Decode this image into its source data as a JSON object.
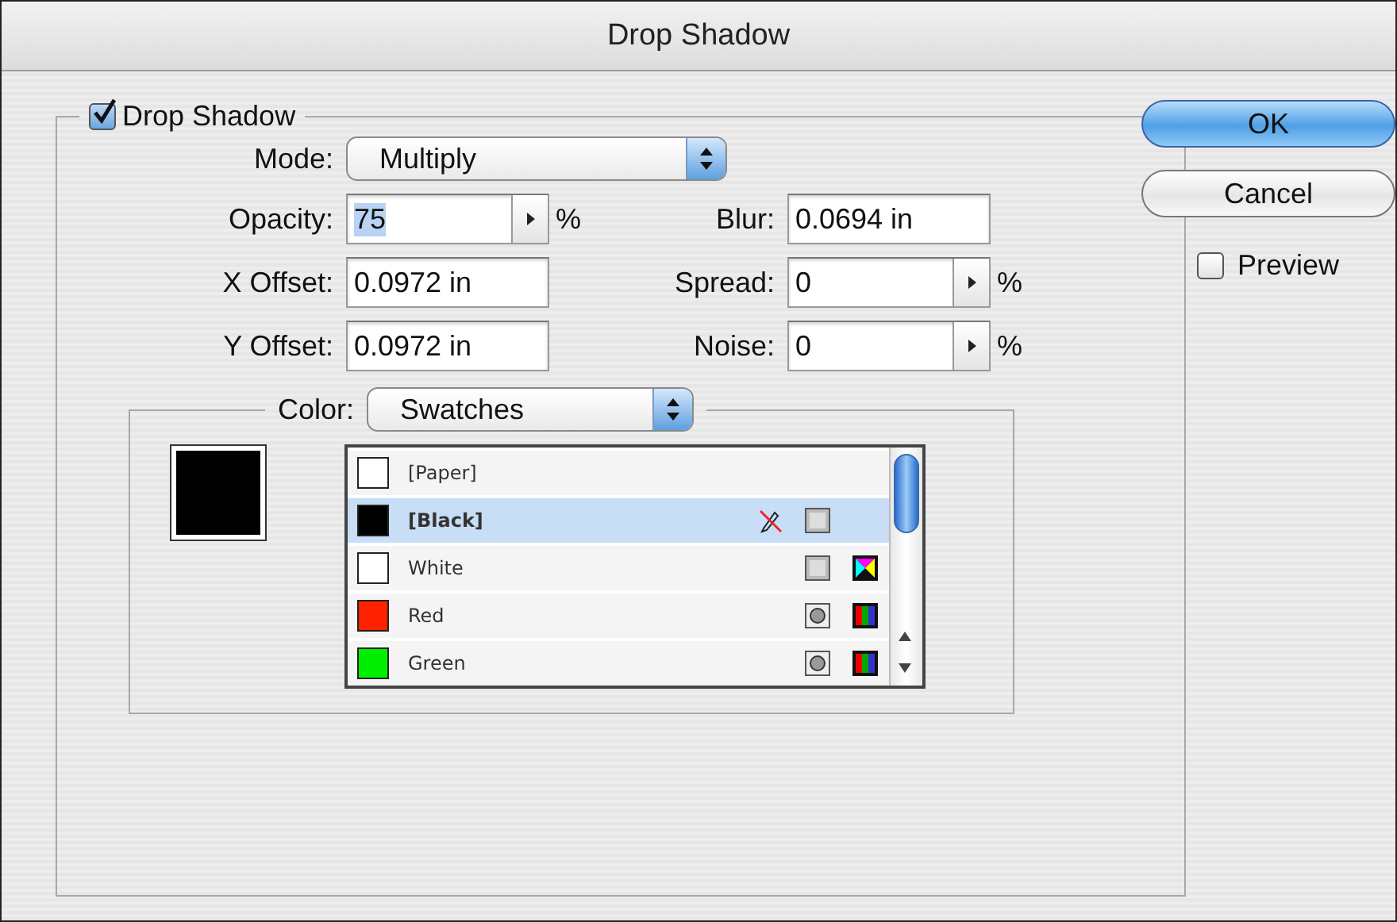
{
  "window": {
    "title": "Drop Shadow"
  },
  "drop_shadow": {
    "label": "Drop Shadow",
    "checked": true
  },
  "mode": {
    "label": "Mode:",
    "value": "Multiply"
  },
  "fields": [
    {
      "label": "Opacity:",
      "value": "75",
      "stepper": true,
      "unit": "%",
      "highlighted": true
    },
    {
      "label": "Blur:",
      "value": "0.0694 in",
      "stepper": false,
      "highlighted": false
    },
    {
      "label": "X Offset:",
      "value": "0.0972 in",
      "stepper": false,
      "highlighted": false
    },
    {
      "label": "Spread:",
      "value": "0",
      "stepper": true,
      "unit": "%",
      "highlighted": false
    },
    {
      "label": "Y Offset:",
      "value": "0.0972 in",
      "stepper": false,
      "highlighted": false
    },
    {
      "label": "Noise:",
      "value": "0",
      "stepper": true,
      "unit": "%",
      "highlighted": false
    }
  ],
  "color": {
    "label": "Color:",
    "value": "Swatches"
  },
  "swatches": [
    {
      "name": "[Paper]",
      "color": "#ffffff",
      "selected": false,
      "locked": false,
      "kind": "none"
    },
    {
      "name": "[Black]",
      "color": "#000000",
      "selected": true,
      "locked": true,
      "kind": "process"
    },
    {
      "name": "White",
      "color": "#ffffff",
      "selected": false,
      "locked": false,
      "kind": "cmyk"
    },
    {
      "name": "Red",
      "color": "#ff2200",
      "selected": false,
      "locked": false,
      "kind": "rgb"
    },
    {
      "name": "Green",
      "color": "#00ee00",
      "selected": false,
      "locked": false,
      "kind": "rgb"
    }
  ],
  "buttons": [
    {
      "label": "OK",
      "default": true
    },
    {
      "label": "Cancel",
      "default": false
    }
  ],
  "preview": {
    "label": "Preview",
    "checked": false
  }
}
